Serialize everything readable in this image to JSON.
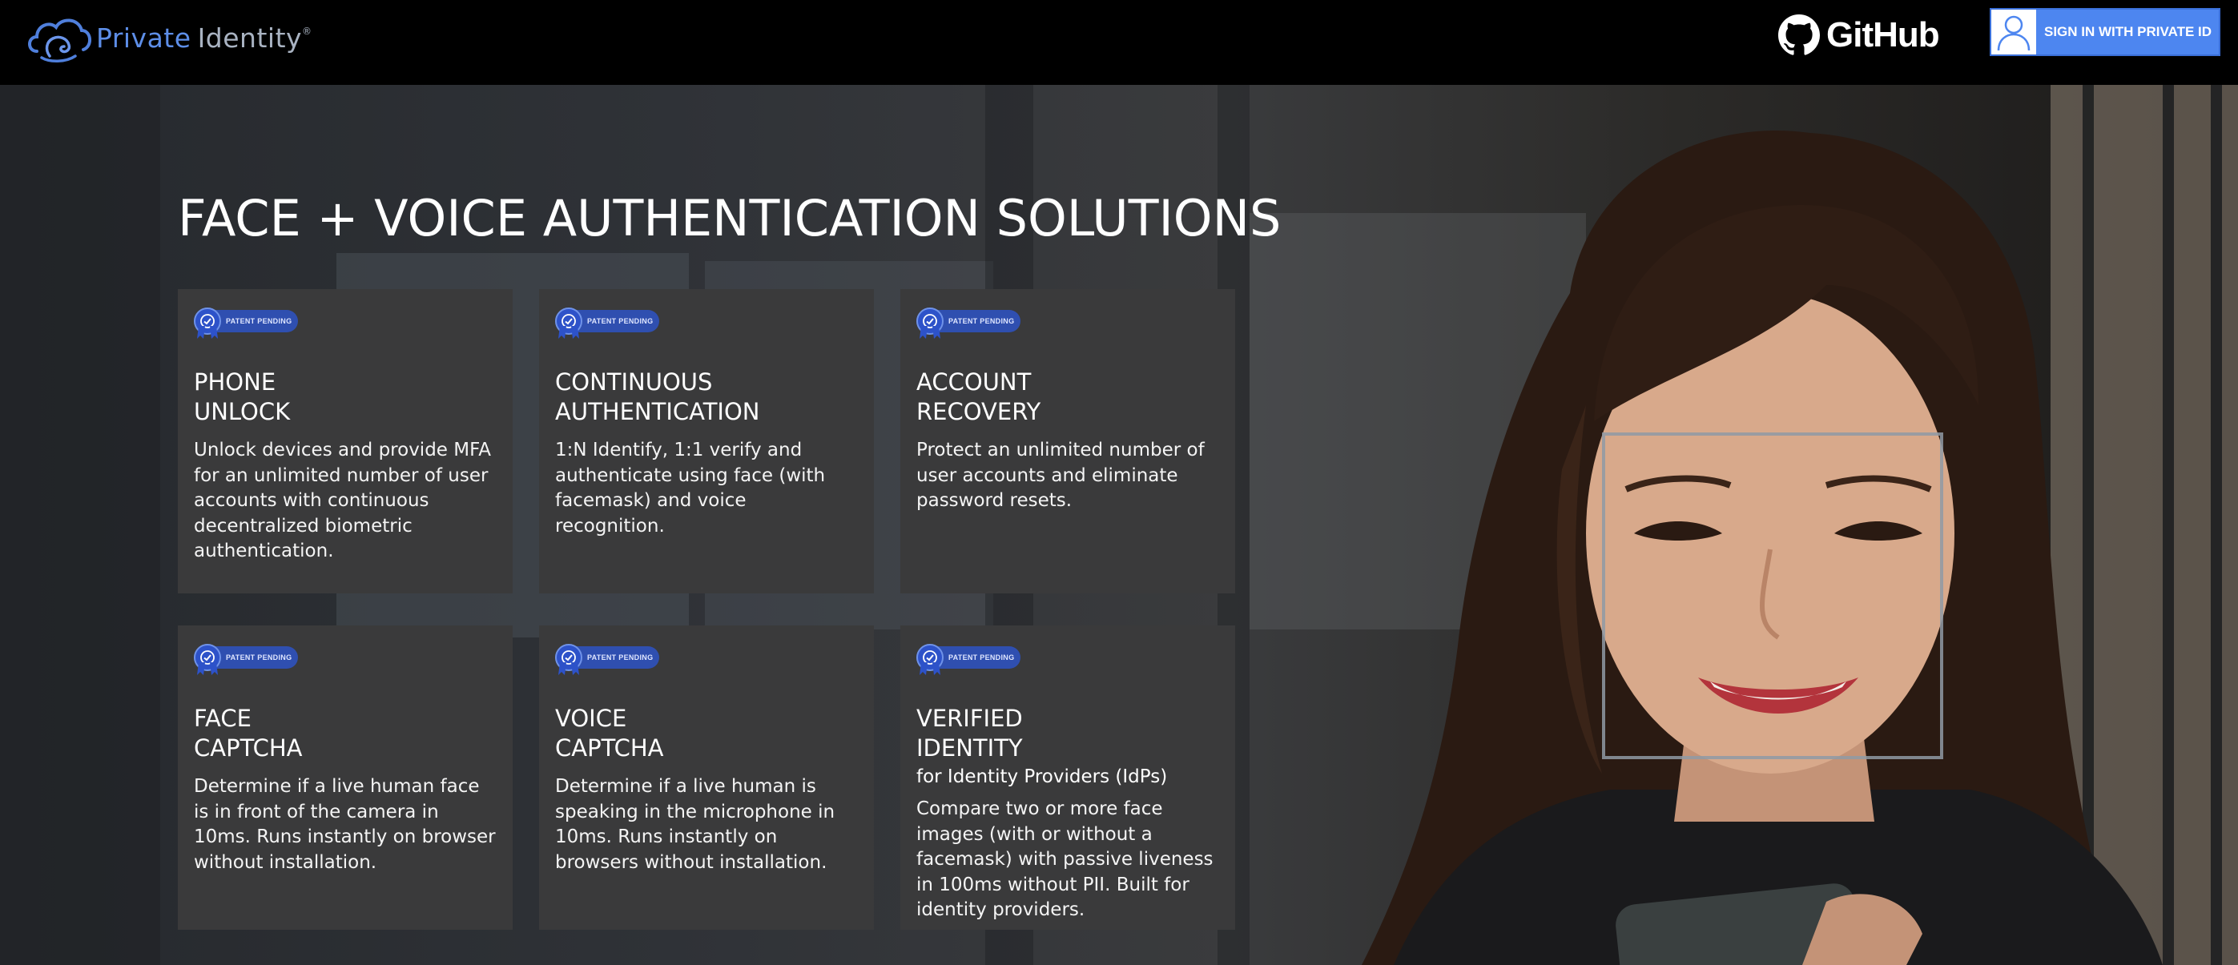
{
  "header": {
    "logo": {
      "name_part1": "Private",
      "name_part2": "Identity",
      "trademark": "®"
    },
    "github_label": "GitHub",
    "signin_label": "SIGN IN WITH PRIVATE ID"
  },
  "hero": {
    "title": "FACE + VOICE AUTHENTICATION SOLUTIONS"
  },
  "cards": [
    {
      "badge": "PATENT PENDING",
      "title_line1": "PHONE",
      "title_line2": "UNLOCK",
      "subtitle": "",
      "description": "Unlock devices and provide MFA for an unlimited number of user accounts with continuous decentralized biometric authentication."
    },
    {
      "badge": "PATENT PENDING",
      "title_line1": "CONTINUOUS",
      "title_line2": "AUTHENTICATION",
      "subtitle": "",
      "description": "1:N Identify, 1:1 verify and authenticate using face (with facemask) and voice recognition."
    },
    {
      "badge": "PATENT PENDING",
      "title_line1": "ACCOUNT",
      "title_line2": "RECOVERY",
      "subtitle": "",
      "description": "Protect an unlimited number of user accounts and eliminate password resets."
    },
    {
      "badge": "PATENT PENDING",
      "title_line1": "FACE",
      "title_line2": "CAPTCHA",
      "subtitle": "",
      "description": "Determine if a live human face is in front of the camera in 10ms. Runs instantly on browser without installation."
    },
    {
      "badge": "PATENT PENDING",
      "title_line1": "VOICE",
      "title_line2": "CAPTCHA",
      "subtitle": "",
      "description": "Determine if a live human is speaking in the microphone in 10ms. Runs instantly on browsers without installation."
    },
    {
      "badge": "PATENT PENDING",
      "title_line1": "VERIFIED",
      "title_line2": "IDENTITY",
      "subtitle": "for Identity Providers (IdPs)",
      "description": "Compare two or more face images (with or without a facemask) with passive liveness in 100ms without PII. Built for identity providers."
    }
  ],
  "icons": {
    "logo": "cloud-face-logo-icon",
    "github": "github-octocat-icon",
    "avatar": "user-avatar-icon",
    "badge": "patent-pending-check-icon"
  },
  "colors": {
    "header_bg": "#000000",
    "accent_blue": "#4d86f0",
    "card_bg": "#3a3a3b",
    "badge_blue": "#2f4fb0",
    "logo_blue": "#5d8ee8"
  }
}
